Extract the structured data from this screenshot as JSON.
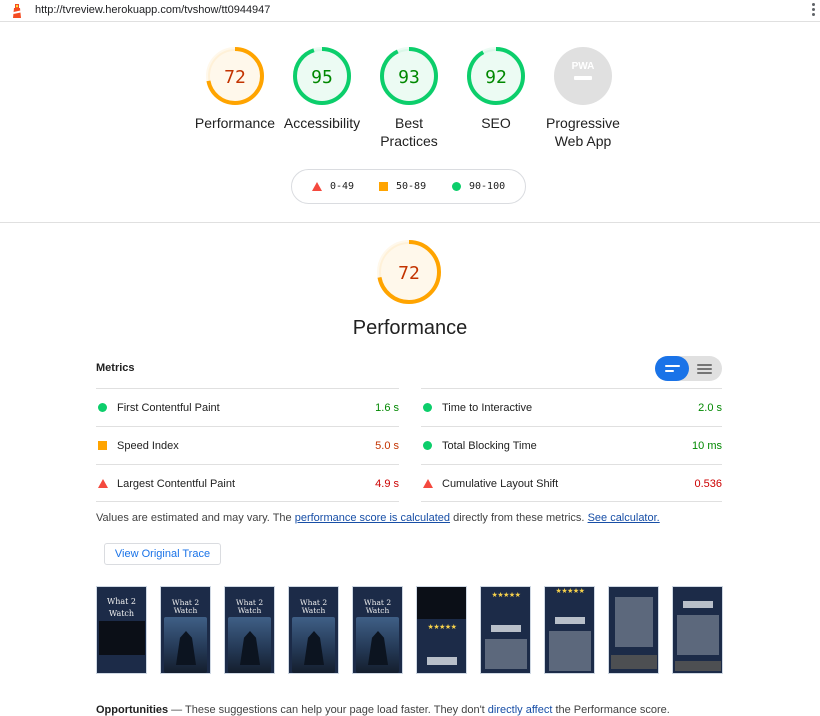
{
  "browser": {
    "url": "http://tvreview.herokuapp.com/tvshow/tt0944947"
  },
  "gauges": [
    {
      "label": "Performance",
      "score": "72",
      "level": "average",
      "fraction": 0.72
    },
    {
      "label": "Accessibility",
      "score": "95",
      "level": "pass",
      "fraction": 0.95
    },
    {
      "label": "Best Practices",
      "score": "93",
      "level": "pass",
      "fraction": 0.93
    },
    {
      "label": "SEO",
      "score": "92",
      "level": "pass",
      "fraction": 0.92
    },
    {
      "label": "Progressive Web App",
      "score": "PWA",
      "level": "na",
      "fraction": 0
    }
  ],
  "legend": [
    {
      "range": "0-49",
      "shape": "triangle",
      "color": "#f4493e"
    },
    {
      "range": "50-89",
      "shape": "square",
      "color": "#ffa400"
    },
    {
      "range": "90-100",
      "shape": "circle",
      "color": "#0cce6b"
    }
  ],
  "colors": {
    "pass": "#0cce6b",
    "pass_text": "#008800",
    "average": "#ffa400",
    "average_text": "#c33300",
    "fail": "#f4493e",
    "fail_text": "#cc0000",
    "link": "#174ea6",
    "accent": "#1a73e8"
  },
  "performance": {
    "score": "72",
    "fraction": 0.72,
    "title": "Performance",
    "metrics_header": "Metrics",
    "metrics": [
      {
        "name": "First Contentful Paint",
        "value": "1.6 s",
        "level": "pass"
      },
      {
        "name": "Time to Interactive",
        "value": "2.0 s",
        "level": "pass"
      },
      {
        "name": "Speed Index",
        "value": "5.0 s",
        "level": "average"
      },
      {
        "name": "Total Blocking Time",
        "value": "10 ms",
        "level": "pass"
      },
      {
        "name": "Largest Contentful Paint",
        "value": "4.9 s",
        "level": "fail"
      },
      {
        "name": "Cumulative Layout Shift",
        "value": "0.536",
        "level": "fail"
      }
    ],
    "note": {
      "prefix": "Values are estimated and may vary. The ",
      "link1": "performance score is calculated",
      "middle": " directly from these metrics. ",
      "link2": "See calculator."
    },
    "trace_button": "View Original Trace",
    "filmstrip_text": {
      "title": "What 2 Watch",
      "what": "What 2",
      "watch": "Watch",
      "stars": "★★★★★"
    }
  },
  "opportunities": {
    "title": "Opportunities",
    "dash": " — ",
    "text_pre": "These suggestions can help your page load faster. They don't ",
    "link": "directly affect",
    "text_post": " the Performance score."
  }
}
